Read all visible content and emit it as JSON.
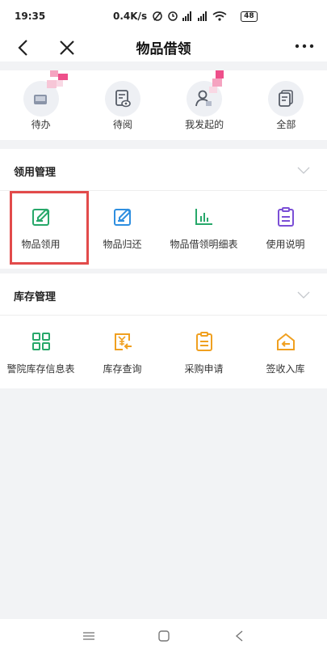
{
  "status": {
    "time": "19:35",
    "speed": "0.4K/s",
    "battery": "48"
  },
  "header": {
    "title": "物品借领"
  },
  "quick": [
    {
      "label": "待办",
      "icon": "inbox-icon"
    },
    {
      "label": "待阅",
      "icon": "read-doc-icon"
    },
    {
      "label": "我发起的",
      "icon": "user-send-icon"
    },
    {
      "label": "全部",
      "icon": "all-docs-icon"
    }
  ],
  "sections": [
    {
      "title": "领用管理",
      "items": [
        {
          "label": "物品领用",
          "icon": "edit-note-icon",
          "color": "#27a86a"
        },
        {
          "label": "物品归还",
          "icon": "edit-note-icon",
          "color": "#2f8fe0"
        },
        {
          "label": "物品借领明细表",
          "icon": "bar-chart-icon",
          "color": "#27a86a"
        },
        {
          "label": "使用说明",
          "icon": "clipboard-icon",
          "color": "#7b4fd6"
        }
      ]
    },
    {
      "title": "库存管理",
      "items": [
        {
          "label": "警院库存信息表",
          "icon": "grid-icon",
          "color": "#27a86a"
        },
        {
          "label": "库存查询",
          "icon": "yuan-doc-icon",
          "color": "#f0a020"
        },
        {
          "label": "采购申请",
          "icon": "clipboard-icon",
          "color": "#f0a020"
        },
        {
          "label": "签收入库",
          "icon": "home-in-icon",
          "color": "#f0a020"
        }
      ]
    }
  ],
  "highlight_color": "#e24b4b"
}
